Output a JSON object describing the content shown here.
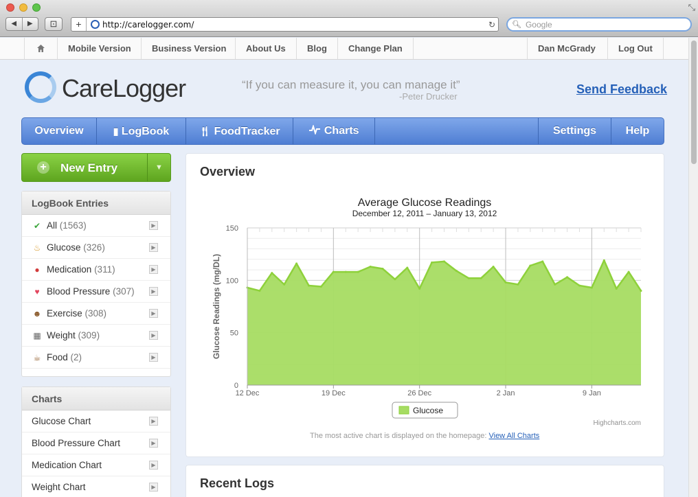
{
  "browser": {
    "url": "http://carelogger.com/",
    "search_placeholder": "Google"
  },
  "topnav": {
    "items": [
      "Mobile Version",
      "Business Version",
      "About Us",
      "Blog",
      "Change Plan"
    ],
    "user": "Dan McGrady",
    "logout": "Log Out"
  },
  "header": {
    "logo": "CareLogger",
    "quote": "“If you can measure it, you can manage it”",
    "quote_author": "-Peter Drucker",
    "feedback": "Send Feedback"
  },
  "mainnav": {
    "overview": "Overview",
    "logbook": "LogBook",
    "foodtracker": "FoodTracker",
    "charts": "Charts",
    "settings": "Settings",
    "help": "Help"
  },
  "sidebar": {
    "new_entry": "New Entry",
    "logbook_title": "LogBook Entries",
    "logbook_items": [
      {
        "label": "All",
        "count": "(1563)",
        "icon": "check-icon"
      },
      {
        "label": "Glucose",
        "count": "(326)",
        "icon": "cake-icon"
      },
      {
        "label": "Medication",
        "count": "(311)",
        "icon": "pill-icon"
      },
      {
        "label": "Blood Pressure",
        "count": "(307)",
        "icon": "heart-icon"
      },
      {
        "label": "Exercise",
        "count": "(308)",
        "icon": "person-icon"
      },
      {
        "label": "Weight",
        "count": "(309)",
        "icon": "scale-icon"
      },
      {
        "label": "Food",
        "count": "(2)",
        "icon": "cup-icon"
      }
    ],
    "charts_title": "Charts",
    "chart_items": [
      "Glucose Chart",
      "Blood Pressure Chart",
      "Medication Chart",
      "Weight Chart"
    ]
  },
  "main": {
    "overview_title": "Overview",
    "footnote": "The most active chart is displayed on the homepage:",
    "footnote_link": "View All Charts",
    "credits": "Highcharts.com",
    "recent_title": "Recent Logs"
  },
  "chart_data": {
    "type": "area",
    "title": "Average Glucose Readings",
    "subtitle": "December 12, 2011 – January 13, 2012",
    "ylabel": "Glucose Readings (mg/DL)",
    "xlabel": "",
    "ylim": [
      0,
      150
    ],
    "yticks": [
      0,
      50,
      100,
      150
    ],
    "xticks": [
      "12 Dec",
      "19 Dec",
      "26 Dec",
      "2 Jan",
      "9 Jan"
    ],
    "grid": true,
    "legend": "bottom-center",
    "color": "#8ed13b",
    "series": [
      {
        "name": "Glucose",
        "x": [
          "2011-12-12",
          "2011-12-13",
          "2011-12-14",
          "2011-12-15",
          "2011-12-16",
          "2011-12-17",
          "2011-12-18",
          "2011-12-19",
          "2011-12-20",
          "2011-12-21",
          "2011-12-22",
          "2011-12-23",
          "2011-12-24",
          "2011-12-25",
          "2011-12-26",
          "2011-12-27",
          "2011-12-28",
          "2011-12-29",
          "2011-12-30",
          "2011-12-31",
          "2012-01-01",
          "2012-01-02",
          "2012-01-03",
          "2012-01-04",
          "2012-01-05",
          "2012-01-06",
          "2012-01-07",
          "2012-01-08",
          "2012-01-09",
          "2012-01-10",
          "2012-01-11",
          "2012-01-12",
          "2012-01-13"
        ],
        "values": [
          93,
          90,
          107,
          96,
          116,
          95,
          94,
          108,
          108,
          108,
          113,
          111,
          101,
          112,
          92,
          117,
          118,
          109,
          102,
          102,
          113,
          98,
          96,
          114,
          118,
          96,
          103,
          95,
          93,
          119,
          92,
          108,
          90
        ]
      }
    ]
  }
}
